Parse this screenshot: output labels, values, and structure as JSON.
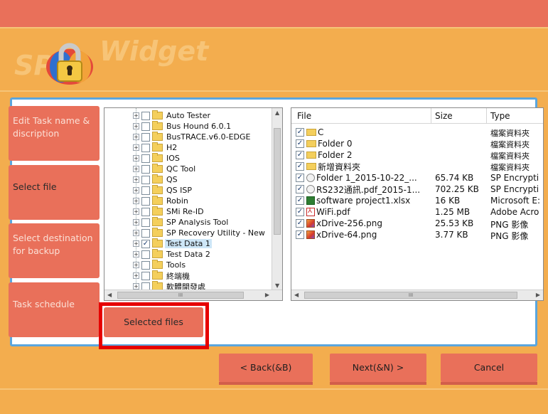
{
  "app": {
    "logo_prefix": "SP",
    "logo_suffix": "Widget",
    "colors": {
      "background": "#f3ad4e",
      "top_bar": "#e9705a",
      "step": "#e9705a",
      "panel_border": "#5aa6de",
      "highlight": "#e60000"
    }
  },
  "steps": [
    {
      "label": "Edit Task name & discription",
      "active": false
    },
    {
      "label": "Select file",
      "active": true
    },
    {
      "label": "Select destination for backup",
      "active": false
    },
    {
      "label": "Task schedule",
      "active": false
    }
  ],
  "tree": {
    "items": [
      {
        "label": "Auto Tester",
        "checked": false
      },
      {
        "label": "Bus Hound 6.0.1",
        "checked": false
      },
      {
        "label": "BusTRACE.v6.0-EDGE",
        "checked": false
      },
      {
        "label": "H2",
        "checked": false
      },
      {
        "label": "IOS",
        "checked": false
      },
      {
        "label": "QC Tool",
        "checked": false
      },
      {
        "label": "QS",
        "checked": false
      },
      {
        "label": "QS ISP",
        "checked": false
      },
      {
        "label": "Robin",
        "checked": false
      },
      {
        "label": "SMi Re-ID",
        "checked": false
      },
      {
        "label": "SP Analysis Tool",
        "checked": false
      },
      {
        "label": "SP Recovery Utility - New",
        "checked": false
      },
      {
        "label": "Test Data 1",
        "checked": true,
        "selected": true
      },
      {
        "label": "Test Data 2",
        "checked": false
      },
      {
        "label": "Tools",
        "checked": false
      },
      {
        "label": "終端機",
        "checked": false
      },
      {
        "label": "軟體開發處",
        "checked": false
      }
    ],
    "hscroll_text": "III"
  },
  "files": {
    "columns": {
      "file": "File",
      "size": "Size",
      "type": "Type"
    },
    "rows": [
      {
        "icon": "folder-icon",
        "name": "C",
        "size": "",
        "type": "檔案資料夾"
      },
      {
        "icon": "folder-icon",
        "name": "Folder 0",
        "size": "",
        "type": "檔案資料夾"
      },
      {
        "icon": "folder-icon",
        "name": "Folder 2",
        "size": "",
        "type": "檔案資料夾"
      },
      {
        "icon": "folder-icon",
        "name": "新增資料夾",
        "size": "",
        "type": "檔案資料夾"
      },
      {
        "icon": "encrypted-file-icon",
        "name": "Folder 1_2015-10-22_...",
        "size": "65.74 KB",
        "type": "SP Encrypti"
      },
      {
        "icon": "encrypted-file-icon",
        "name": "RS232通訊.pdf_2015-1...",
        "size": "702.25 KB",
        "type": "SP Encrypti"
      },
      {
        "icon": "excel-file-icon",
        "name": "software project1.xlsx",
        "size": "16 KB",
        "type": "Microsoft E:"
      },
      {
        "icon": "pdf-file-icon",
        "name": "WiFi.pdf",
        "size": "1.25 MB",
        "type": "Adobe Acro"
      },
      {
        "icon": "png-file-icon",
        "name": "xDrive-256.png",
        "size": "25.53 KB",
        "type": "PNG 影像"
      },
      {
        "icon": "png-file-icon",
        "name": "xDrive-64.png",
        "size": "3.77 KB",
        "type": "PNG 影像"
      }
    ],
    "hscroll_text": "III"
  },
  "buttons": {
    "selected_files": "Selected files",
    "back": "< Back(&B)",
    "next": "Next(&N) >",
    "cancel": "Cancel"
  }
}
